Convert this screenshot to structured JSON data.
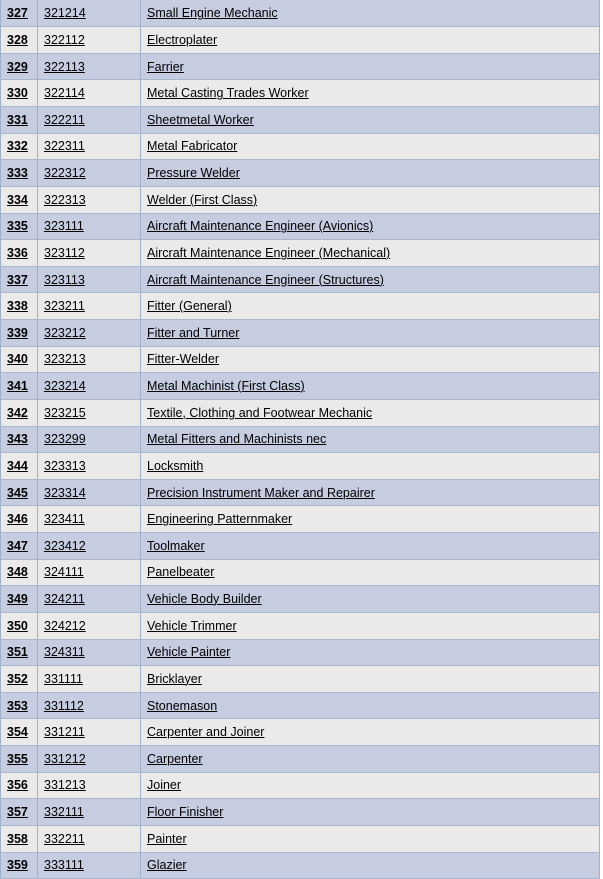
{
  "table": {
    "columns": [
      "index",
      "code",
      "title"
    ],
    "rows": [
      {
        "index": "327",
        "code": "321214",
        "title": "Small Engine Mechanic"
      },
      {
        "index": "328",
        "code": "322112",
        "title": "Electroplater"
      },
      {
        "index": "329",
        "code": "322113",
        "title": "Farrier"
      },
      {
        "index": "330",
        "code": "322114",
        "title": "Metal Casting Trades Worker"
      },
      {
        "index": "331",
        "code": "322211",
        "title": "Sheetmetal Worker"
      },
      {
        "index": "332",
        "code": "322311",
        "title": "Metal Fabricator"
      },
      {
        "index": "333",
        "code": "322312",
        "title": "Pressure Welder"
      },
      {
        "index": "334",
        "code": "322313",
        "title": "Welder (First Class)"
      },
      {
        "index": "335",
        "code": "323111",
        "title": "Aircraft Maintenance Engineer (Avionics)"
      },
      {
        "index": "336",
        "code": "323112",
        "title": "Aircraft Maintenance Engineer (Mechanical)"
      },
      {
        "index": "337",
        "code": "323113",
        "title": "Aircraft Maintenance Engineer (Structures)"
      },
      {
        "index": "338",
        "code": "323211",
        "title": "Fitter (General)"
      },
      {
        "index": "339",
        "code": "323212",
        "title": "Fitter and Turner"
      },
      {
        "index": "340",
        "code": "323213",
        "title": "Fitter-Welder"
      },
      {
        "index": "341",
        "code": "323214",
        "title": "Metal Machinist (First Class)"
      },
      {
        "index": "342",
        "code": "323215",
        "title": "Textile, Clothing and Footwear Mechanic"
      },
      {
        "index": "343",
        "code": "323299",
        "title": "Metal Fitters and Machinists nec"
      },
      {
        "index": "344",
        "code": "323313",
        "title": "Locksmith"
      },
      {
        "index": "345",
        "code": "323314",
        "title": "Precision Instrument Maker and Repairer"
      },
      {
        "index": "346",
        "code": "323411",
        "title": "Engineering Patternmaker"
      },
      {
        "index": "347",
        "code": "323412",
        "title": "Toolmaker"
      },
      {
        "index": "348",
        "code": "324111",
        "title": "Panelbeater"
      },
      {
        "index": "349",
        "code": "324211",
        "title": "Vehicle Body Builder"
      },
      {
        "index": "350",
        "code": "324212",
        "title": "Vehicle Trimmer"
      },
      {
        "index": "351",
        "code": "324311",
        "title": "Vehicle Painter"
      },
      {
        "index": "352",
        "code": "331111",
        "title": "Bricklayer"
      },
      {
        "index": "353",
        "code": "331112",
        "title": "Stonemason"
      },
      {
        "index": "354",
        "code": "331211",
        "title": "Carpenter and Joiner"
      },
      {
        "index": "355",
        "code": "331212",
        "title": "Carpenter"
      },
      {
        "index": "356",
        "code": "331213",
        "title": "Joiner"
      },
      {
        "index": "357",
        "code": "332111",
        "title": "Floor Finisher"
      },
      {
        "index": "358",
        "code": "332211",
        "title": "Painter"
      },
      {
        "index": "359",
        "code": "333111",
        "title": "Glazier"
      }
    ]
  },
  "colors": {
    "band_blue": "#c6cde1",
    "band_light": "#eceae8",
    "grid_line": "#a8b6d0",
    "text": "#000000"
  }
}
